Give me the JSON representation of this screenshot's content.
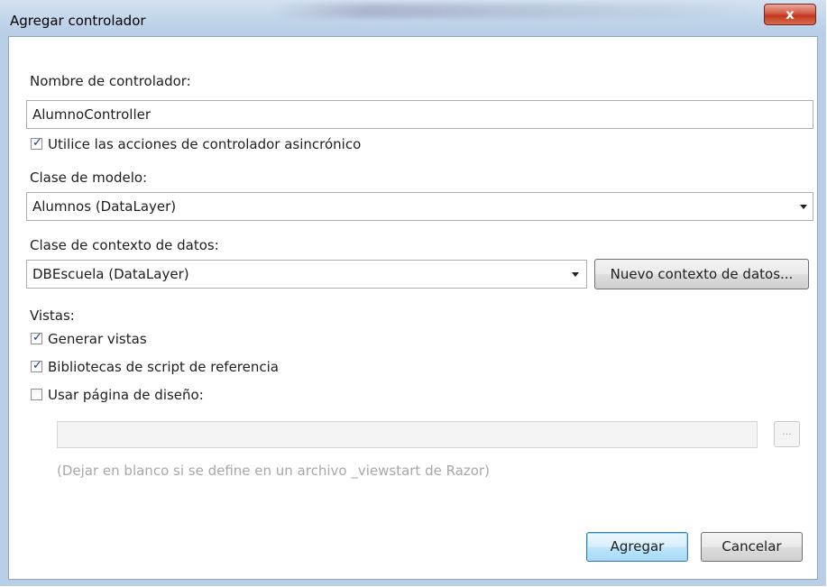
{
  "window": {
    "title": "Agregar controlador",
    "close_glyph": "x"
  },
  "form": {
    "controller_name_label": "Nombre de controlador:",
    "controller_name_value": "AlumnoController",
    "async_actions": {
      "label": "Utilice las acciones de controlador asincrónico",
      "checked": true
    },
    "model_class_label": "Clase de modelo:",
    "model_class_value": "Alumnos (DataLayer)",
    "data_context_label": "Clase de contexto de datos:",
    "data_context_value": "DBEscuela (DataLayer)",
    "new_context_button": "Nuevo contexto de datos...",
    "views_label": "Vistas:",
    "generate_views": {
      "label": "Generar vistas",
      "checked": true
    },
    "script_libraries": {
      "label": "Bibliotecas de script de referencia",
      "checked": true
    },
    "use_layout_page": {
      "label": "Usar página de diseño:",
      "checked": false
    },
    "layout_page_value": "",
    "browse_button": "...",
    "layout_hint": "(Dejar en blanco si se define en un archivo _viewstart de Razor)"
  },
  "buttons": {
    "add": "Agregar",
    "cancel": "Cancelar"
  },
  "colors": {
    "default_button_border": "#3c7fb1",
    "checkmark": "#1f3f8a",
    "hint_text": "#a7a7a7"
  }
}
